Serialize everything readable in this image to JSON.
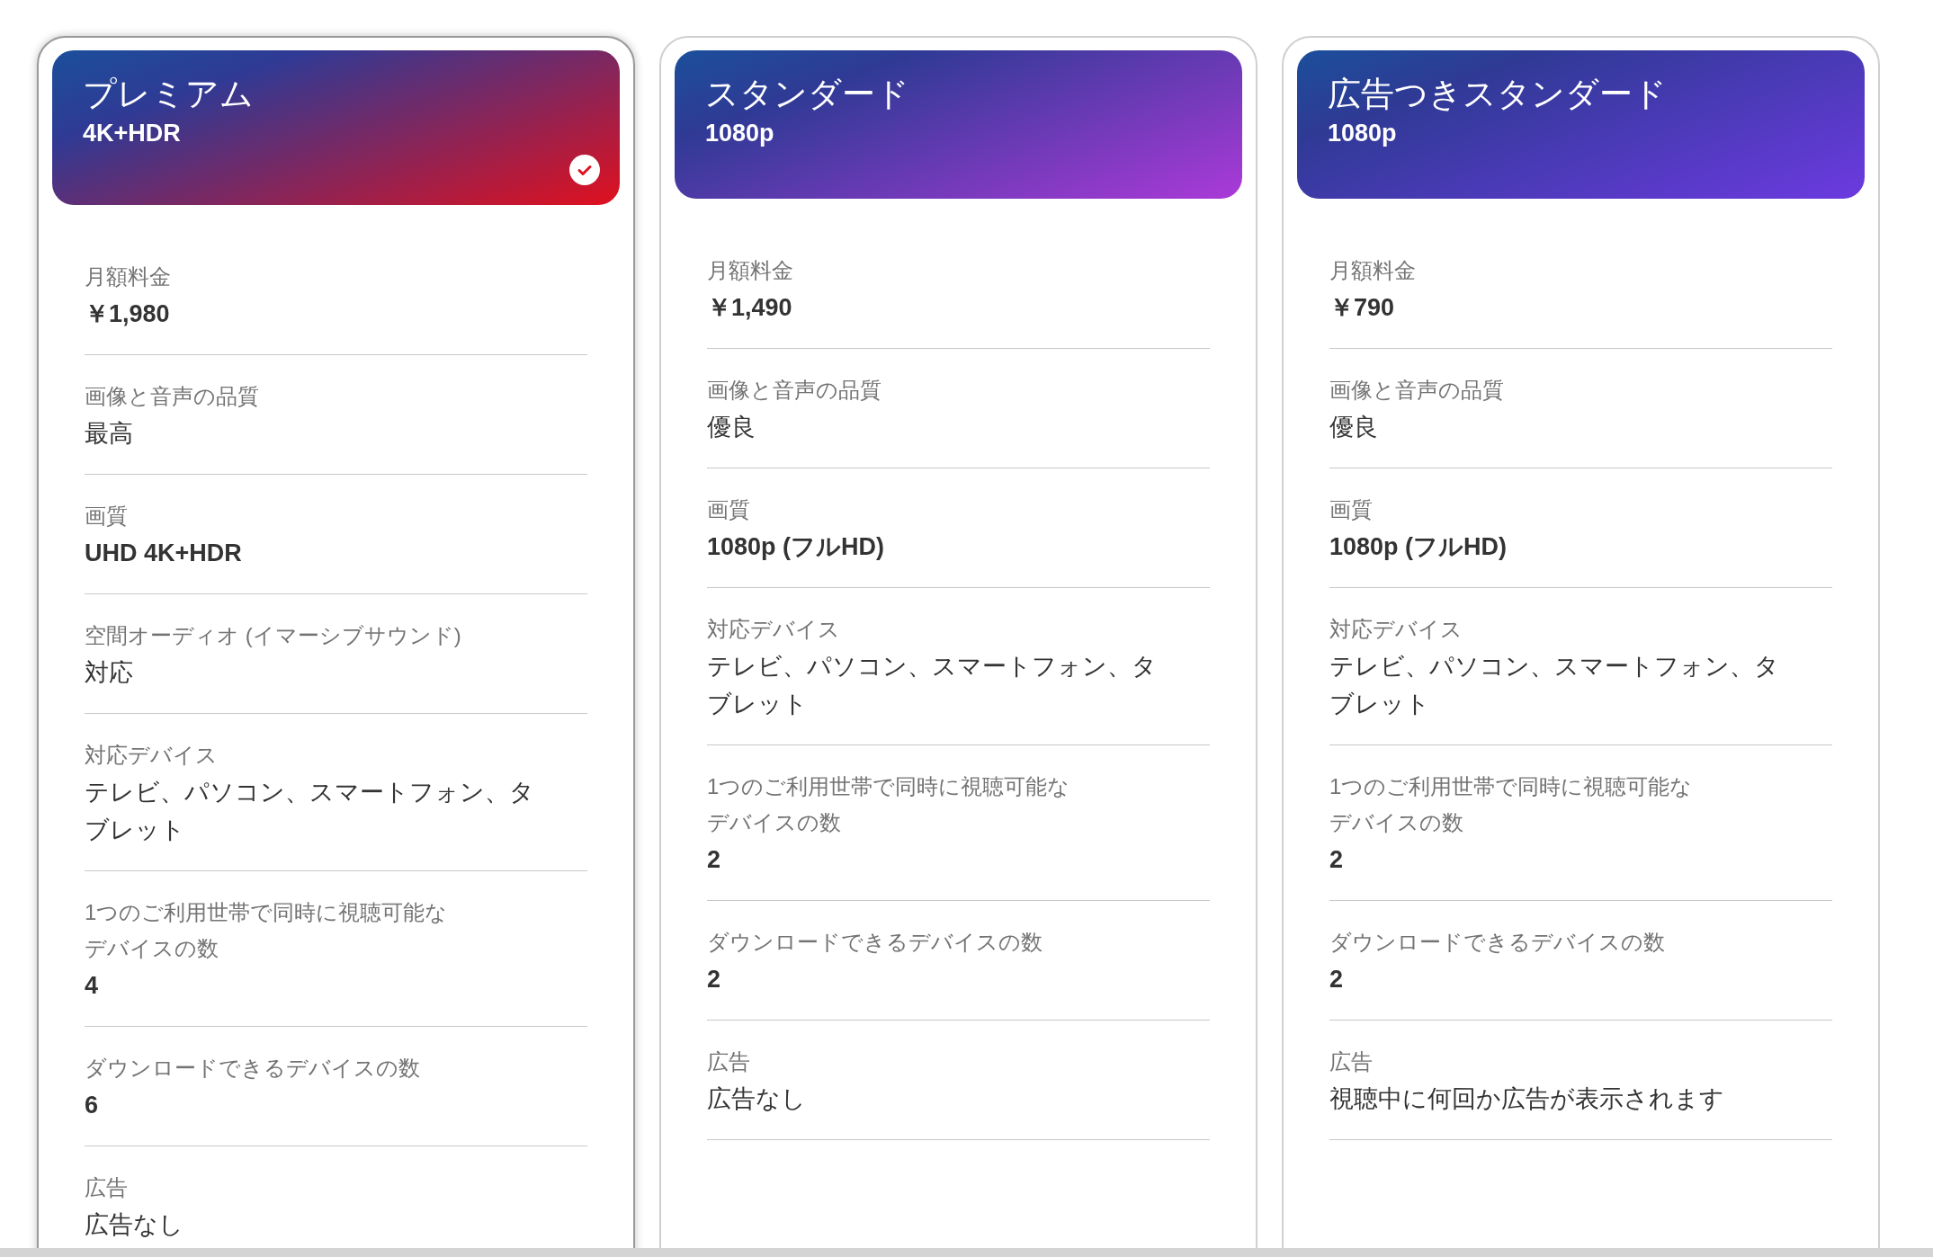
{
  "plans": [
    {
      "name": "プレミアム",
      "resolution": "4K+HDR",
      "selected": true,
      "color": "#e0101e",
      "rows": [
        {
          "label": "月額料金",
          "value": "￥1,980",
          "bold": true
        },
        {
          "label": "画像と音声の品質",
          "value": "最高",
          "bold": false
        },
        {
          "label": "画質",
          "value": "UHD 4K+HDR",
          "bold": true
        },
        {
          "label": "空間オーディオ (イマーシブサウンド)",
          "value": "対応",
          "bold": false
        },
        {
          "label": "対応デバイス",
          "value": "テレビ、パソコン、スマートフォン、タブレット",
          "bold": false
        },
        {
          "label": "1つのご利用世帯で同時に視聴可能なデバイスの数",
          "value": "4",
          "bold": true
        },
        {
          "label": "ダウンロードできるデバイスの数",
          "value": "6",
          "bold": true
        },
        {
          "label": "広告",
          "value": "広告なし",
          "bold": false
        }
      ]
    },
    {
      "name": "スタンダード",
      "resolution": "1080p",
      "selected": false,
      "color": "#ab3ad8",
      "rows": [
        {
          "label": "月額料金",
          "value": "￥1,490",
          "bold": true
        },
        {
          "label": "画像と音声の品質",
          "value": "優良",
          "bold": false
        },
        {
          "label": "画質",
          "value": "1080p (フルHD)",
          "bold": true
        },
        {
          "label": "対応デバイス",
          "value": "テレビ、パソコン、スマートフォン、タブレット",
          "bold": false
        },
        {
          "label": "1つのご利用世帯で同時に視聴可能なデバイスの数",
          "value": "2",
          "bold": true
        },
        {
          "label": "ダウンロードできるデバイスの数",
          "value": "2",
          "bold": true
        },
        {
          "label": "広告",
          "value": "広告なし",
          "bold": false
        }
      ]
    },
    {
      "name": "広告つきスタンダード",
      "resolution": "1080p",
      "selected": false,
      "color": "#6c3ae0",
      "rows": [
        {
          "label": "月額料金",
          "value": "￥790",
          "bold": true
        },
        {
          "label": "画像と音声の品質",
          "value": "優良",
          "bold": false
        },
        {
          "label": "画質",
          "value": "1080p (フルHD)",
          "bold": true
        },
        {
          "label": "対応デバイス",
          "value": "テレビ、パソコン、スマートフォン、タブレット",
          "bold": false
        },
        {
          "label": "1つのご利用世帯で同時に視聴可能なデバイスの数",
          "value": "2",
          "bold": true
        },
        {
          "label": "ダウンロードできるデバイスの数",
          "value": "2",
          "bold": true
        },
        {
          "label": "広告",
          "value": "視聴中に何回か広告が表示されます",
          "bold": false
        }
      ]
    }
  ]
}
